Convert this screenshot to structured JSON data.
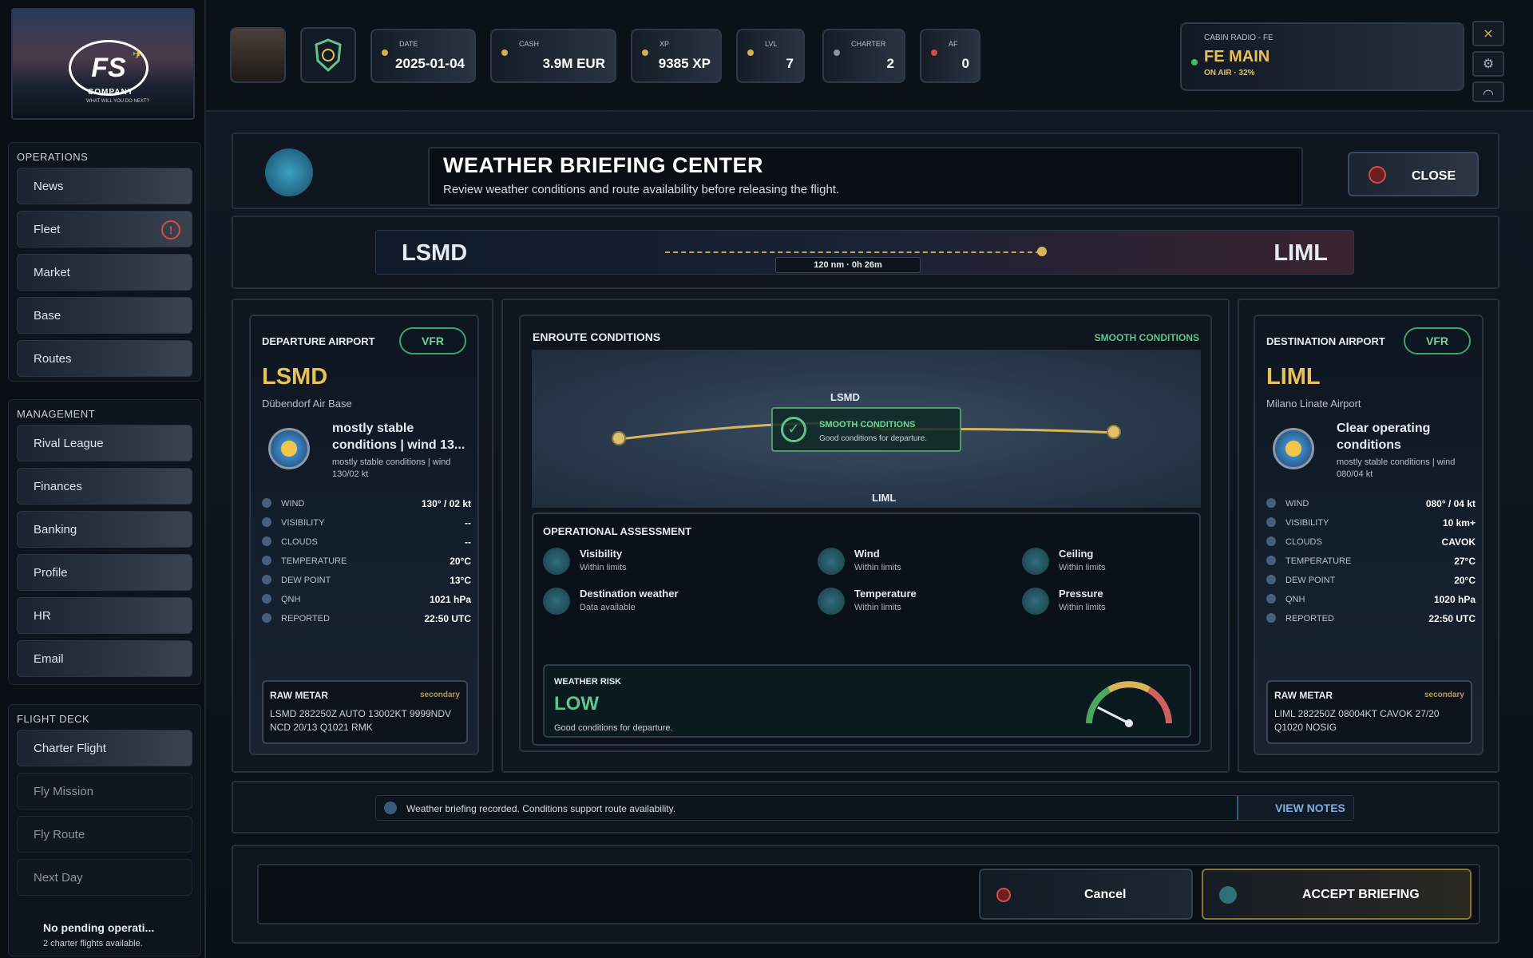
{
  "topbar": {
    "date_label": "DATE",
    "date": "2025-01-04",
    "cash_label": "CASH",
    "cash": "3.9M EUR",
    "xp_label": "XP",
    "xp": "9385 XP",
    "lvl_label": "LVL",
    "lvl": "7",
    "charter_label": "CHARTER",
    "charter": "2",
    "af_label": "AF",
    "af": "0",
    "radio_label": "CABIN RADIO - FE",
    "radio_channel": "FE MAIN",
    "radio_status": "ON AIR · 32%",
    "close_icon": "×"
  },
  "sidebar": {
    "operations_title": "OPERATIONS",
    "operations": [
      "News",
      "Fleet",
      "Market",
      "Base",
      "Routes"
    ],
    "fleet_alert": "!",
    "management_title": "MANAGEMENT",
    "management": [
      "Rival League",
      "Finances",
      "Banking",
      "Profile",
      "HR",
      "Email"
    ],
    "flightdeck_title": "FLIGHT DECK",
    "flightdeck": [
      "Charter Flight",
      "Fly Mission",
      "Fly Route",
      "Next Day"
    ],
    "pending_title": "No pending operati...",
    "pending_sub": "2 charter flights available."
  },
  "logo": {
    "main": "FS",
    "company": "COMPANY",
    "tag": "WHAT WILL YOU DO NEXT?"
  },
  "header": {
    "title": "WEATHER BRIEFING CENTER",
    "subtitle": "Review weather conditions and route availability before releasing the flight.",
    "close": "CLOSE"
  },
  "route": {
    "dep": "LSMD",
    "arr": "LIML",
    "dist": "120 nm  ·  0h 26m"
  },
  "departure": {
    "heading": "DEPARTURE AIRPORT",
    "badge": "VFR",
    "code": "LSMD",
    "name": "Dübendorf Air Base",
    "summary": "mostly stable conditions | wind 13...",
    "detail": "mostly stable conditions | wind 130/02 kt",
    "rows": [
      {
        "k": "Wind",
        "v": "130° / 02 kt"
      },
      {
        "k": "Visibility",
        "v": "--"
      },
      {
        "k": "Clouds",
        "v": "--"
      },
      {
        "k": "Temperature",
        "v": "20°C"
      },
      {
        "k": "Dew point",
        "v": "13°C"
      },
      {
        "k": "QNH",
        "v": "1021 hPa"
      },
      {
        "k": "Reported",
        "v": "22:50 UTC"
      }
    ],
    "metar_title": "RAW METAR",
    "metar_tag": "secondary",
    "metar": "LSMD 282250Z AUTO 13002KT 9999NDV NCD 20/13 Q1021 RMK"
  },
  "destination": {
    "heading": "DESTINATION AIRPORT",
    "badge": "VFR",
    "code": "LIML",
    "name": "Milano Linate Airport",
    "summary": "Clear operating conditions",
    "detail": "mostly stable conditions | wind 080/04 kt",
    "rows": [
      {
        "k": "Wind",
        "v": "080° / 04 kt"
      },
      {
        "k": "Visibility",
        "v": "10 km+"
      },
      {
        "k": "Clouds",
        "v": "CAVOK"
      },
      {
        "k": "Temperature",
        "v": "27°C"
      },
      {
        "k": "Dew point",
        "v": "20°C"
      },
      {
        "k": "QNH",
        "v": "1020 hPa"
      },
      {
        "k": "Reported",
        "v": "22:50 UTC"
      }
    ],
    "metar_title": "RAW METAR",
    "metar_tag": "secondary",
    "metar": "LIML 282250Z 08004KT CAVOK 27/20 Q1020 NOSIG"
  },
  "enroute": {
    "title": "ENROUTE CONDITIONS",
    "status": "SMOOTH CONDITIONS",
    "map_dep": "LSMD",
    "map_arr": "LIML",
    "bubble_title": "SMOOTH CONDITIONS",
    "bubble_sub": "Good conditions for departure.",
    "ops_title": "OPERATIONAL ASSESSMENT",
    "ops": [
      {
        "t": "Visibility",
        "s": "Within limits"
      },
      {
        "t": "Wind",
        "s": "Within limits"
      },
      {
        "t": "Ceiling",
        "s": "Within limits"
      },
      {
        "t": "Destination weather",
        "s": "Data available"
      },
      {
        "t": "Temperature",
        "s": "Within limits"
      },
      {
        "t": "Pressure",
        "s": "Within limits"
      }
    ],
    "risk_label": "WEATHER RISK",
    "risk_value": "LOW",
    "risk_sub": "Good conditions for departure.",
    "risk_level": 0.15
  },
  "notes": {
    "text": "Weather briefing recorded. Conditions support route availability.",
    "button": "VIEW NOTES"
  },
  "actions": {
    "cancel": "Cancel",
    "accept": "ACCEPT BRIEFING"
  },
  "colors": {
    "accent": "#e7c15a",
    "success": "#5fc58a",
    "danger": "#d84a4a"
  }
}
